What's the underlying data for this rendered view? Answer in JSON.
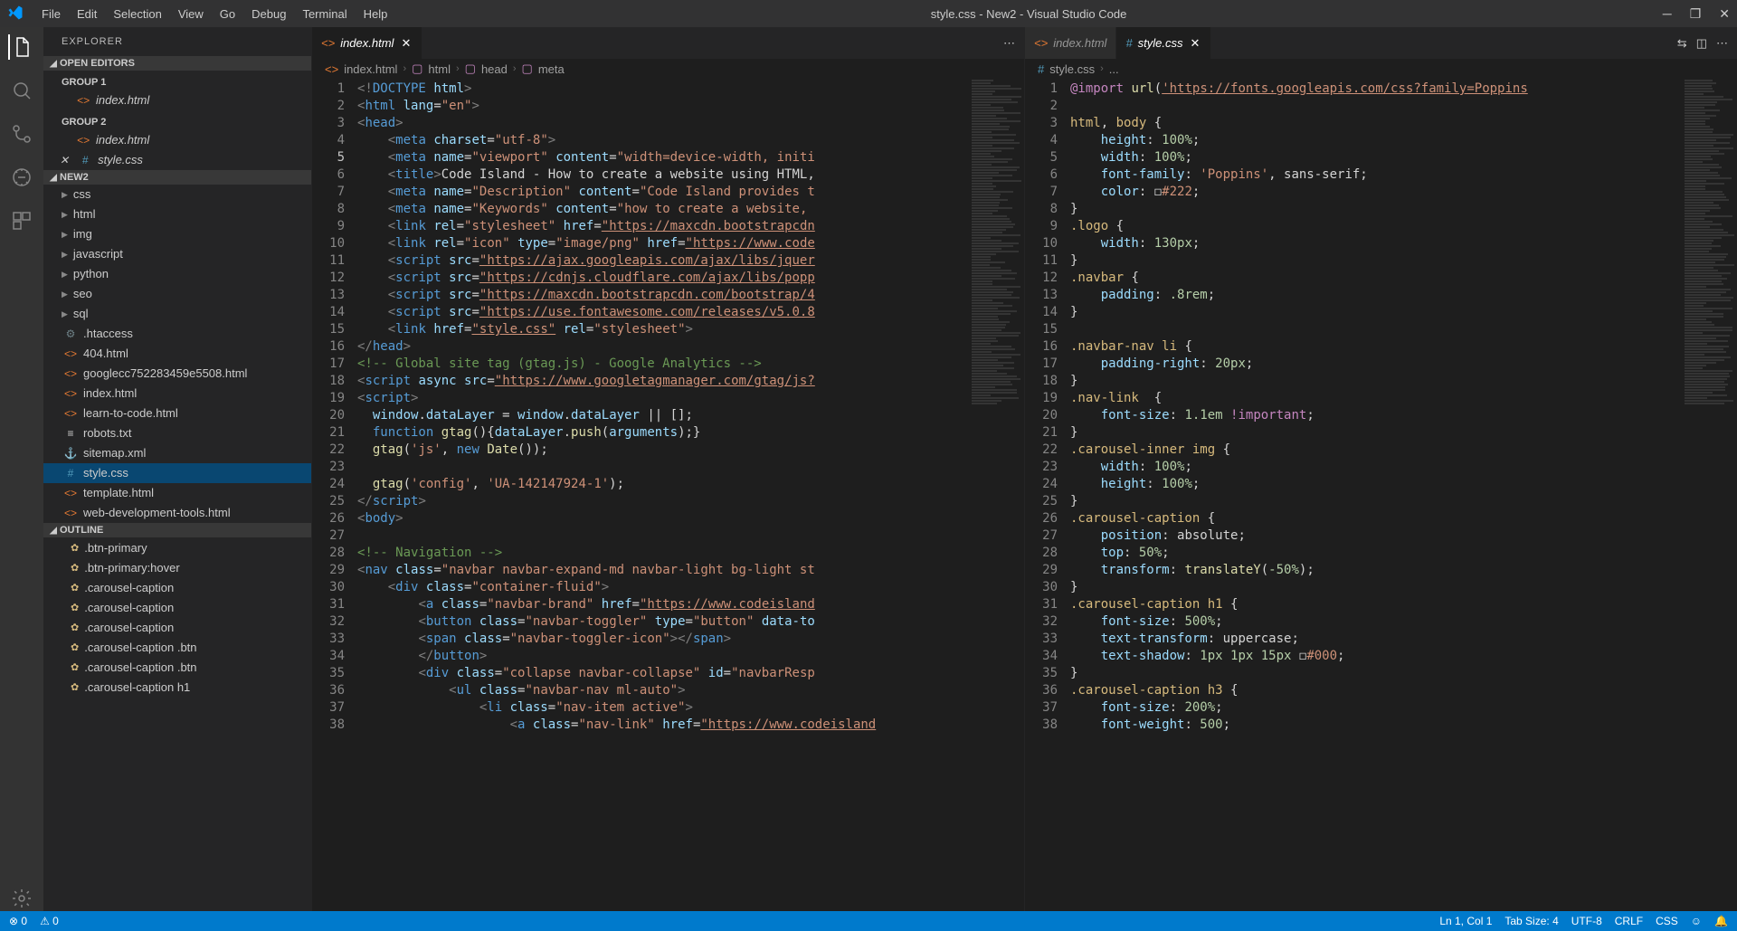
{
  "window": {
    "title": "style.css - New2 - Visual Studio Code",
    "menus": [
      "File",
      "Edit",
      "Selection",
      "View",
      "Go",
      "Debug",
      "Terminal",
      "Help"
    ]
  },
  "sidebar": {
    "title": "EXPLORER",
    "openEditors": "OPEN EDITORS",
    "group1": "GROUP 1",
    "group2": "GROUP 2",
    "file1": "index.html",
    "file2": "index.html",
    "file3": "style.css",
    "project": "NEW2",
    "folders": [
      "css",
      "html",
      "img",
      "javascript",
      "python",
      "seo",
      "sql"
    ],
    "files": [
      {
        "name": ".htaccess",
        "icon": "gear"
      },
      {
        "name": "404.html",
        "icon": "html"
      },
      {
        "name": "googlecc752283459e5508.html",
        "icon": "html"
      },
      {
        "name": "index.html",
        "icon": "html"
      },
      {
        "name": "learn-to-code.html",
        "icon": "html"
      },
      {
        "name": "robots.txt",
        "icon": "txt"
      },
      {
        "name": "sitemap.xml",
        "icon": "xml"
      },
      {
        "name": "style.css",
        "icon": "css",
        "selected": true
      },
      {
        "name": "template.html",
        "icon": "html"
      },
      {
        "name": "web-development-tools.html",
        "icon": "html"
      }
    ],
    "outline": "OUTLINE",
    "outlineItems": [
      ".btn-primary",
      ".btn-primary:hover",
      ".carousel-caption",
      ".carousel-caption",
      ".carousel-caption",
      ".carousel-caption .btn",
      ".carousel-caption .btn",
      ".carousel-caption h1"
    ]
  },
  "editorLeft": {
    "tab": "index.html",
    "breadcrumb": [
      "index.html",
      "html",
      "head",
      "meta"
    ],
    "currentLine": 5,
    "code": [
      {
        "n": 1,
        "html": "<span class='tk-punc'>&lt;!</span><span class='tk-tag'>DOCTYPE</span> <span class='tk-attr'>html</span><span class='tk-punc'>&gt;</span>"
      },
      {
        "n": 2,
        "html": "<span class='tk-punc'>&lt;</span><span class='tk-tag'>html</span> <span class='tk-attr'>lang</span>=<span class='tk-str'>\"en\"</span><span class='tk-punc'>&gt;</span>"
      },
      {
        "n": 3,
        "html": "<span class='tk-punc'>&lt;</span><span class='tk-tag'>head</span><span class='tk-punc'>&gt;</span>"
      },
      {
        "n": 4,
        "html": "    <span class='tk-punc'>&lt;</span><span class='tk-tag'>meta</span> <span class='tk-attr'>charset</span>=<span class='tk-str'>\"utf-8\"</span><span class='tk-punc'>&gt;</span>"
      },
      {
        "n": 5,
        "html": "    <span class='tk-punc'>&lt;</span><span class='tk-tag'>meta</span> <span class='tk-attr'>name</span>=<span class='tk-str'>\"viewport\"</span> <span class='tk-attr'>content</span>=<span class='tk-str'>\"width=device-width, initi</span>"
      },
      {
        "n": 6,
        "html": "    <span class='tk-punc'>&lt;</span><span class='tk-tag'>title</span><span class='tk-punc'>&gt;</span>Code Island - How to create a website using HTML,"
      },
      {
        "n": 7,
        "html": "    <span class='tk-punc'>&lt;</span><span class='tk-tag'>meta</span> <span class='tk-attr'>name</span>=<span class='tk-str'>\"Description\"</span> <span class='tk-attr'>content</span>=<span class='tk-str'>\"Code Island provides t</span>"
      },
      {
        "n": 8,
        "html": "    <span class='tk-punc'>&lt;</span><span class='tk-tag'>meta</span> <span class='tk-attr'>name</span>=<span class='tk-str'>\"Keywords\"</span> <span class='tk-attr'>content</span>=<span class='tk-str'>\"how to create a website, </span>"
      },
      {
        "n": 9,
        "html": "    <span class='tk-punc'>&lt;</span><span class='tk-tag'>link</span> <span class='tk-attr'>rel</span>=<span class='tk-str'>\"stylesheet\"</span> <span class='tk-attr'>href</span>=<span class='tk-str tk-link'>\"https://maxcdn.bootstrapcdn</span>"
      },
      {
        "n": 10,
        "html": "    <span class='tk-punc'>&lt;</span><span class='tk-tag'>link</span> <span class='tk-attr'>rel</span>=<span class='tk-str'>\"icon\"</span> <span class='tk-attr'>type</span>=<span class='tk-str'>\"image/png\"</span> <span class='tk-attr'>href</span>=<span class='tk-str tk-link'>\"https://www.code</span>"
      },
      {
        "n": 11,
        "html": "    <span class='tk-punc'>&lt;</span><span class='tk-tag'>script</span> <span class='tk-attr'>src</span>=<span class='tk-str tk-link'>\"https://ajax.googleapis.com/ajax/libs/jquer</span>"
      },
      {
        "n": 12,
        "html": "    <span class='tk-punc'>&lt;</span><span class='tk-tag'>script</span> <span class='tk-attr'>src</span>=<span class='tk-str tk-link'>\"https://cdnjs.cloudflare.com/ajax/libs/popp</span>"
      },
      {
        "n": 13,
        "html": "    <span class='tk-punc'>&lt;</span><span class='tk-tag'>script</span> <span class='tk-attr'>src</span>=<span class='tk-str tk-link'>\"https://maxcdn.bootstrapcdn.com/bootstrap/4</span>"
      },
      {
        "n": 14,
        "html": "    <span class='tk-punc'>&lt;</span><span class='tk-tag'>script</span> <span class='tk-attr'>src</span>=<span class='tk-str tk-link'>\"https://use.fontawesome.com/releases/v5.0.8</span>"
      },
      {
        "n": 15,
        "html": "    <span class='tk-punc'>&lt;</span><span class='tk-tag'>link</span> <span class='tk-attr'>href</span>=<span class='tk-str tk-link'>\"style.css\"</span> <span class='tk-attr'>rel</span>=<span class='tk-str'>\"stylesheet\"</span><span class='tk-punc'>&gt;</span>"
      },
      {
        "n": 16,
        "html": "<span class='tk-punc'>&lt;/</span><span class='tk-tag'>head</span><span class='tk-punc'>&gt;</span>"
      },
      {
        "n": 17,
        "html": "<span class='tk-cmt'>&lt;!-- Global site tag (gtag.js) - Google Analytics --&gt;</span>"
      },
      {
        "n": 18,
        "html": "<span class='tk-punc'>&lt;</span><span class='tk-tag'>script</span> <span class='tk-attr'>async</span> <span class='tk-attr'>src</span>=<span class='tk-str tk-link'>\"https://www.googletagmanager.com/gtag/js?</span>"
      },
      {
        "n": 19,
        "html": "<span class='tk-punc'>&lt;</span><span class='tk-tag'>script</span><span class='tk-punc'>&gt;</span>"
      },
      {
        "n": 20,
        "html": "  <span class='tk-attr'>window</span>.<span class='tk-attr'>dataLayer</span> = <span class='tk-attr'>window</span>.<span class='tk-attr'>dataLayer</span> || [];"
      },
      {
        "n": 21,
        "html": "  <span class='tk-const'>function</span> <span class='tk-fn'>gtag</span>(){<span class='tk-attr'>dataLayer</span>.<span class='tk-fn'>push</span>(<span class='tk-attr'>arguments</span>);}"
      },
      {
        "n": 22,
        "html": "  <span class='tk-fn'>gtag</span>(<span class='tk-str'>'js'</span>, <span class='tk-const'>new</span> <span class='tk-fn'>Date</span>());"
      },
      {
        "n": 23,
        "html": ""
      },
      {
        "n": 24,
        "html": "  <span class='tk-fn'>gtag</span>(<span class='tk-str'>'config'</span>, <span class='tk-str'>'UA-142147924-1'</span>);"
      },
      {
        "n": 25,
        "html": "<span class='tk-punc'>&lt;/</span><span class='tk-tag'>script</span><span class='tk-punc'>&gt;</span>"
      },
      {
        "n": 26,
        "html": "<span class='tk-punc'>&lt;</span><span class='tk-tag'>body</span><span class='tk-punc'>&gt;</span>"
      },
      {
        "n": 27,
        "html": ""
      },
      {
        "n": 28,
        "html": "<span class='tk-cmt'>&lt;!-- Navigation --&gt;</span>"
      },
      {
        "n": 29,
        "html": "<span class='tk-punc'>&lt;</span><span class='tk-tag'>nav</span> <span class='tk-attr'>class</span>=<span class='tk-str'>\"navbar navbar-expand-md navbar-light bg-light st</span>"
      },
      {
        "n": 30,
        "html": "    <span class='tk-punc'>&lt;</span><span class='tk-tag'>div</span> <span class='tk-attr'>class</span>=<span class='tk-str'>\"container-fluid\"</span><span class='tk-punc'>&gt;</span>"
      },
      {
        "n": 31,
        "html": "        <span class='tk-punc'>&lt;</span><span class='tk-tag'>a</span> <span class='tk-attr'>class</span>=<span class='tk-str'>\"navbar-brand\"</span> <span class='tk-attr'>href</span>=<span class='tk-str tk-link'>\"https://www.codeisland</span>"
      },
      {
        "n": 32,
        "html": "        <span class='tk-punc'>&lt;</span><span class='tk-tag'>button</span> <span class='tk-attr'>class</span>=<span class='tk-str'>\"navbar-toggler\"</span> <span class='tk-attr'>type</span>=<span class='tk-str'>\"button\"</span> <span class='tk-attr'>data-to</span>"
      },
      {
        "n": 33,
        "html": "        <span class='tk-punc'>&lt;</span><span class='tk-tag'>span</span> <span class='tk-attr'>class</span>=<span class='tk-str'>\"navbar-toggler-icon\"</span><span class='tk-punc'>&gt;&lt;/</span><span class='tk-tag'>span</span><span class='tk-punc'>&gt;</span>"
      },
      {
        "n": 34,
        "html": "        <span class='tk-punc'>&lt;/</span><span class='tk-tag'>button</span><span class='tk-punc'>&gt;</span>"
      },
      {
        "n": 35,
        "html": "        <span class='tk-punc'>&lt;</span><span class='tk-tag'>div</span> <span class='tk-attr'>class</span>=<span class='tk-str'>\"collapse navbar-collapse\"</span> <span class='tk-attr'>id</span>=<span class='tk-str'>\"navbarResp</span>"
      },
      {
        "n": 36,
        "html": "            <span class='tk-punc'>&lt;</span><span class='tk-tag'>ul</span> <span class='tk-attr'>class</span>=<span class='tk-str'>\"navbar-nav ml-auto\"</span><span class='tk-punc'>&gt;</span>"
      },
      {
        "n": 37,
        "html": "                <span class='tk-punc'>&lt;</span><span class='tk-tag'>li</span> <span class='tk-attr'>class</span>=<span class='tk-str'>\"nav-item active\"</span><span class='tk-punc'>&gt;</span>"
      },
      {
        "n": 38,
        "html": "                    <span class='tk-punc'>&lt;</span><span class='tk-tag'>a</span> <span class='tk-attr'>class</span>=<span class='tk-str'>\"nav-link\"</span> <span class='tk-attr'>href</span>=<span class='tk-str tk-link'>\"https://www.codeisland</span>"
      }
    ]
  },
  "editorRight": {
    "tab1": "index.html",
    "tab2": "style.css",
    "breadcrumb": [
      "style.css",
      "..."
    ],
    "code": [
      {
        "n": 1,
        "html": "<span class='tk-kw'>@import</span> <span class='tk-fn'>url</span>(<span class='tk-str tk-link'>'https://fonts.googleapis.com/css?family=Poppins</span>"
      },
      {
        "n": 2,
        "html": ""
      },
      {
        "n": 3,
        "html": "<span class='tk-sel'>html</span>, <span class='tk-sel'>body</span> {"
      },
      {
        "n": 4,
        "html": "    <span class='tk-prop'>height</span>: <span class='tk-num'>100%</span>;"
      },
      {
        "n": 5,
        "html": "    <span class='tk-prop'>width</span>: <span class='tk-num'>100%</span>;"
      },
      {
        "n": 6,
        "html": "    <span class='tk-prop'>font-family</span>: <span class='tk-str'>'Poppins'</span>, sans-serif;"
      },
      {
        "n": 7,
        "html": "    <span class='tk-prop'>color</span>: ◻<span class='tk-str'>#222</span>;"
      },
      {
        "n": 8,
        "html": "}"
      },
      {
        "n": 9,
        "html": "<span class='tk-sel'>.logo</span> {"
      },
      {
        "n": 10,
        "html": "    <span class='tk-prop'>width</span>: <span class='tk-num'>130px</span>;"
      },
      {
        "n": 11,
        "html": "}"
      },
      {
        "n": 12,
        "html": "<span class='tk-sel'>.navbar</span> {"
      },
      {
        "n": 13,
        "html": "    <span class='tk-prop'>padding</span>: <span class='tk-num'>.8rem</span>;"
      },
      {
        "n": 14,
        "html": "}"
      },
      {
        "n": 15,
        "html": ""
      },
      {
        "n": 16,
        "html": "<span class='tk-sel'>.navbar-nav li</span> {"
      },
      {
        "n": 17,
        "html": "    <span class='tk-prop'>padding-right</span>: <span class='tk-num'>20px</span>;"
      },
      {
        "n": 18,
        "html": "}"
      },
      {
        "n": 19,
        "html": "<span class='tk-sel'>.nav-link</span>  {"
      },
      {
        "n": 20,
        "html": "    <span class='tk-prop'>font-size</span>: <span class='tk-num'>1.1em</span> <span class='tk-kw'>!important</span>;"
      },
      {
        "n": 21,
        "html": "}"
      },
      {
        "n": 22,
        "html": "<span class='tk-sel'>.carousel-inner img</span> {"
      },
      {
        "n": 23,
        "html": "    <span class='tk-prop'>width</span>: <span class='tk-num'>100%</span>;"
      },
      {
        "n": 24,
        "html": "    <span class='tk-prop'>height</span>: <span class='tk-num'>100%</span>;"
      },
      {
        "n": 25,
        "html": "}"
      },
      {
        "n": 26,
        "html": "<span class='tk-sel'>.carousel-caption</span> {"
      },
      {
        "n": 27,
        "html": "    <span class='tk-prop'>position</span>: absolute;"
      },
      {
        "n": 28,
        "html": "    <span class='tk-prop'>top</span>: <span class='tk-num'>50%</span>;"
      },
      {
        "n": 29,
        "html": "    <span class='tk-prop'>transform</span>: <span class='tk-fn'>translateY</span>(<span class='tk-num'>-50%</span>);"
      },
      {
        "n": 30,
        "html": "}"
      },
      {
        "n": 31,
        "html": "<span class='tk-sel'>.carousel-caption h1</span> {"
      },
      {
        "n": 32,
        "html": "    <span class='tk-prop'>font-size</span>: <span class='tk-num'>500%</span>;"
      },
      {
        "n": 33,
        "html": "    <span class='tk-prop'>text-transform</span>: uppercase;"
      },
      {
        "n": 34,
        "html": "    <span class='tk-prop'>text-shadow</span>: <span class='tk-num'>1px 1px 15px</span> ◻<span class='tk-str'>#000</span>;"
      },
      {
        "n": 35,
        "html": "}"
      },
      {
        "n": 36,
        "html": "<span class='tk-sel'>.carousel-caption h3</span> {"
      },
      {
        "n": 37,
        "html": "    <span class='tk-prop'>font-size</span>: <span class='tk-num'>200%</span>;"
      },
      {
        "n": 38,
        "html": "    <span class='tk-prop'>font-weight</span>: <span class='tk-num'>500</span>;"
      }
    ]
  },
  "status": {
    "errors": "0",
    "warnings": "0",
    "pos": "Ln 1, Col 1",
    "tab": "Tab Size: 4",
    "enc": "UTF-8",
    "eol": "CRLF",
    "lang": "CSS"
  }
}
